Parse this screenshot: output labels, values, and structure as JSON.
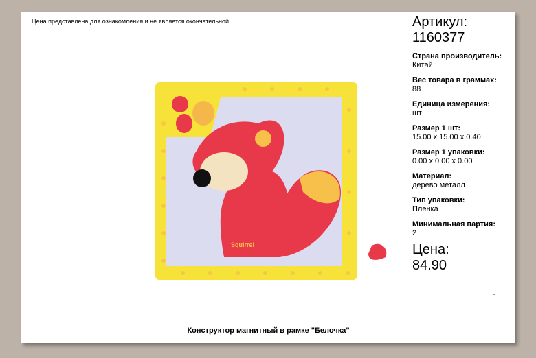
{
  "notice": "Цена представлена для ознакомления и не является окончательной",
  "article": {
    "label": "Артикул:",
    "value": "1160377"
  },
  "specs": [
    {
      "label": "Страна производитель:",
      "value": "Китай"
    },
    {
      "label": "Вес товара в граммах:",
      "value": "88"
    },
    {
      "label": "Единица измерения:",
      "value": "шт"
    },
    {
      "label": "Размер 1 шт:",
      "value": "15.00 x 15.00 x 0.40"
    },
    {
      "label": "Размер 1 упаковки:",
      "value": "0.00 x 0.00 x 0.00"
    },
    {
      "label": "Материал:",
      "value": "дерево металл"
    },
    {
      "label": "Тип упаковки:",
      "value": "Пленка"
    },
    {
      "label": "Минимальная партия:",
      "value": "2"
    }
  ],
  "price": {
    "label": "Цена:",
    "value": "84.90"
  },
  "product_title": "Конструктор магнитный в рамке \"Белочка\"",
  "image_text": "Squirrel"
}
